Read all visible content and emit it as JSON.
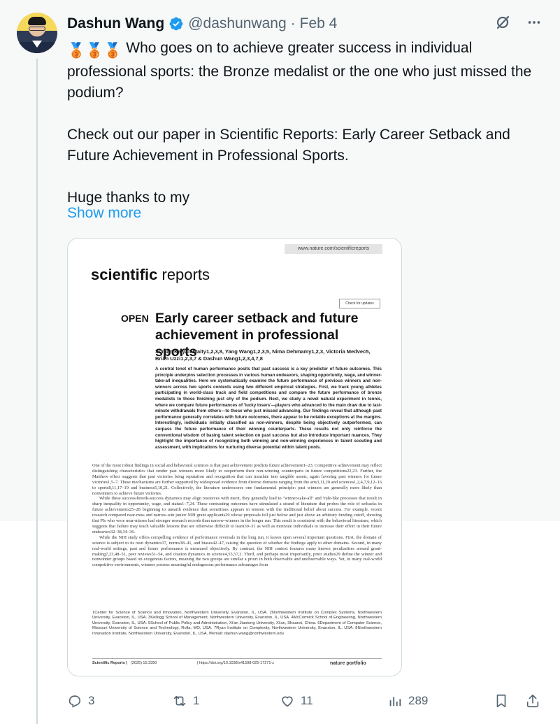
{
  "tweet": {
    "author_name": "Dashun Wang",
    "handle": "@dashunwang",
    "separator": "·",
    "date": "Feb 4",
    "text_line1": "Who goes on to achieve greater success in individual professional sports: the Bronze medalist or the one who just missed the podium?",
    "text_line2": "Check out our paper in Scientific Reports: Early Career Setback and Future Achievement in Professional Sports.",
    "text_line3": "Huge thanks to my",
    "show_more": "Show more",
    "medal_emoji": "🥉🥉🥉"
  },
  "paper": {
    "url": "www.nature.com/scientificreports",
    "journal_bold": "scientific",
    "journal_rest": " reports",
    "check_updates": "Check for updates",
    "open_label": "OPEN",
    "title": "Early career setback and future achievement in professional sports",
    "authors": "Suman Kalyan Maity1,2,3,8, Yang Wang1,2,3,5, Nima Dehmamy1,2,3, Victoria Medvec5, Brian Uzzi1,2,3,7 & Dashun Wang1,2,3,4,7,8",
    "abstract": "A central tenet of human performance posits that past success is a key predictor of future outcomes. This principle underpins selection processes in various human endeavors, shaping opportunity, wage, and winner-take-all inequalities. Here we systematically examine the future performance of previous winners and non-winners across two sports contexts using two different empirical strategies. First, we track young athletes participating in world-class track and field competitions and compare the future performance of bronze medalists to those finishing just shy of the podium. Next, we study a novel natural experiment in tennis, where we compare future performances of 'lucky losers'—players who advanced to the main draw due to last-minute withdrawals from others—to those who just missed advancing. Our findings reveal that although past performance generally correlates with future outcomes, there appear to be notable exceptions at the margins. Interestingly, individuals initially classified as non-winners, despite being objectively outperformed, can surpass the future performance of their winning counterparts. These results not only reinforce the conventional wisdom of basing talent selection on past success but also introduce important nuances. They highlight the importance of recognizing both winning and non-winning experiences in talent scouting and assessment, with implications for nurturing diverse potential within talent pools.",
    "para1": "One of the most robust findings in social and behavioral sciences is that past achievement predicts future achievement1–23. Competitive achievement may reflect distinguishing characteristics that render past winners more likely to outperform their non-winning counterparts in future competitions22,23. Further, the Matthew effect suggests that past victories bring reputation and recognition that can translate into tangible assets, again favoring past winners for future victories1,5–7. These mechanisms are further supported by widespread evidence from diverse domains ranging from the arts3,11,20 and sciences1,2,4,7,9,12–16 to sports8,11,17–19 and business5,10,21. Collectively, the literature underscores one fundamental principle: past winners are generally more likely than nonwinners to achieve future victories.",
    "para2": "While these success-breeds-success dynamics may align resources with merit, they generally lead to \"winner-take-all\" and Yule-like processes that result in sharp inequality in opportunity, wage, and status1–7,24. These contrasting outcomes have stimulated a strand of literature that probes the role of setbacks in future achievements25–28 beginning to unearth evidence that sometimes appears in tension with the traditional belief about success. For example, recent research compared near-miss and narrow-win junior NIH grant applicants29 whose proposals fell just below and just above an arbitrary funding cutoff, showing that PIs who were near-misses had stronger research records than narrow-winners in the longer run. This result is consistent with the behavioral literature, which suggests that failure may teach valuable lessons that are otherwise difficult to learn30–31 as well as motivate individuals to increase their effort in their future endeavors32–38,34–36.",
    "para3": "While the NIH study offers compelling evidence of performance reversals in the long run, it leaves open several important questions. First, the domain of science is subject to its own dynamics37, norms38–41, and biases42–47, raising the question of whether the findings apply to other domains. Second, in many real-world settings, past and future performance is measured objectively. By contrast, the NIH context features many known peculiarities around grant-making7,23,48–51, peer reviews51–54, and citation dynamics in science4,55,57,2. Third, and perhaps most importantly, prior studies29 define the winner and nonwinner groups based on exogenous factors, meaning the two groups are similar a priori in both observable and unobservable ways. Yet, in many real-world competitive environments, winners possess meaningful endogenous performance advantages from",
    "affiliations": "1Center for Science of Science and Innovation, Northwestern University, Evanston, IL, USA. 2Northwestern Institute on Complex Systems, Northwestern University, Evanston, IL, USA. 3Kellogg School of Management, Northwestern University, Evanston, IL, USA. 4McCormick School of Engineering, Northwestern University, Evanston, IL, USA. 5School of Public Policy and Administration, Xi'an Jiaotong University, Xi'an, Shaanxi, China. 6Department of Computer Science, Missouri University of Science and Technology, Rolla, MO, USA. 7Ryan Institute on Complexity, Northwestern University, Evanston, IL, USA. 8Northwestern Innovation Institute, Northwestern University, Evanston, IL, USA. ✉email: dashun.wang@northwestern.edu",
    "footer_journal": "Scientific Reports |",
    "footer_volume": "(2025) 15:3350",
    "footer_doi": "| https://doi.org/10.1038/s41598-025-17271-z",
    "footer_publisher": "nature portfolio"
  },
  "actions": {
    "replies": "3",
    "reposts": "1",
    "likes": "11",
    "views": "289"
  },
  "colors": {
    "accent": "#1d9bf0",
    "secondary_text": "#536471",
    "verified": "#1d9bf0"
  }
}
